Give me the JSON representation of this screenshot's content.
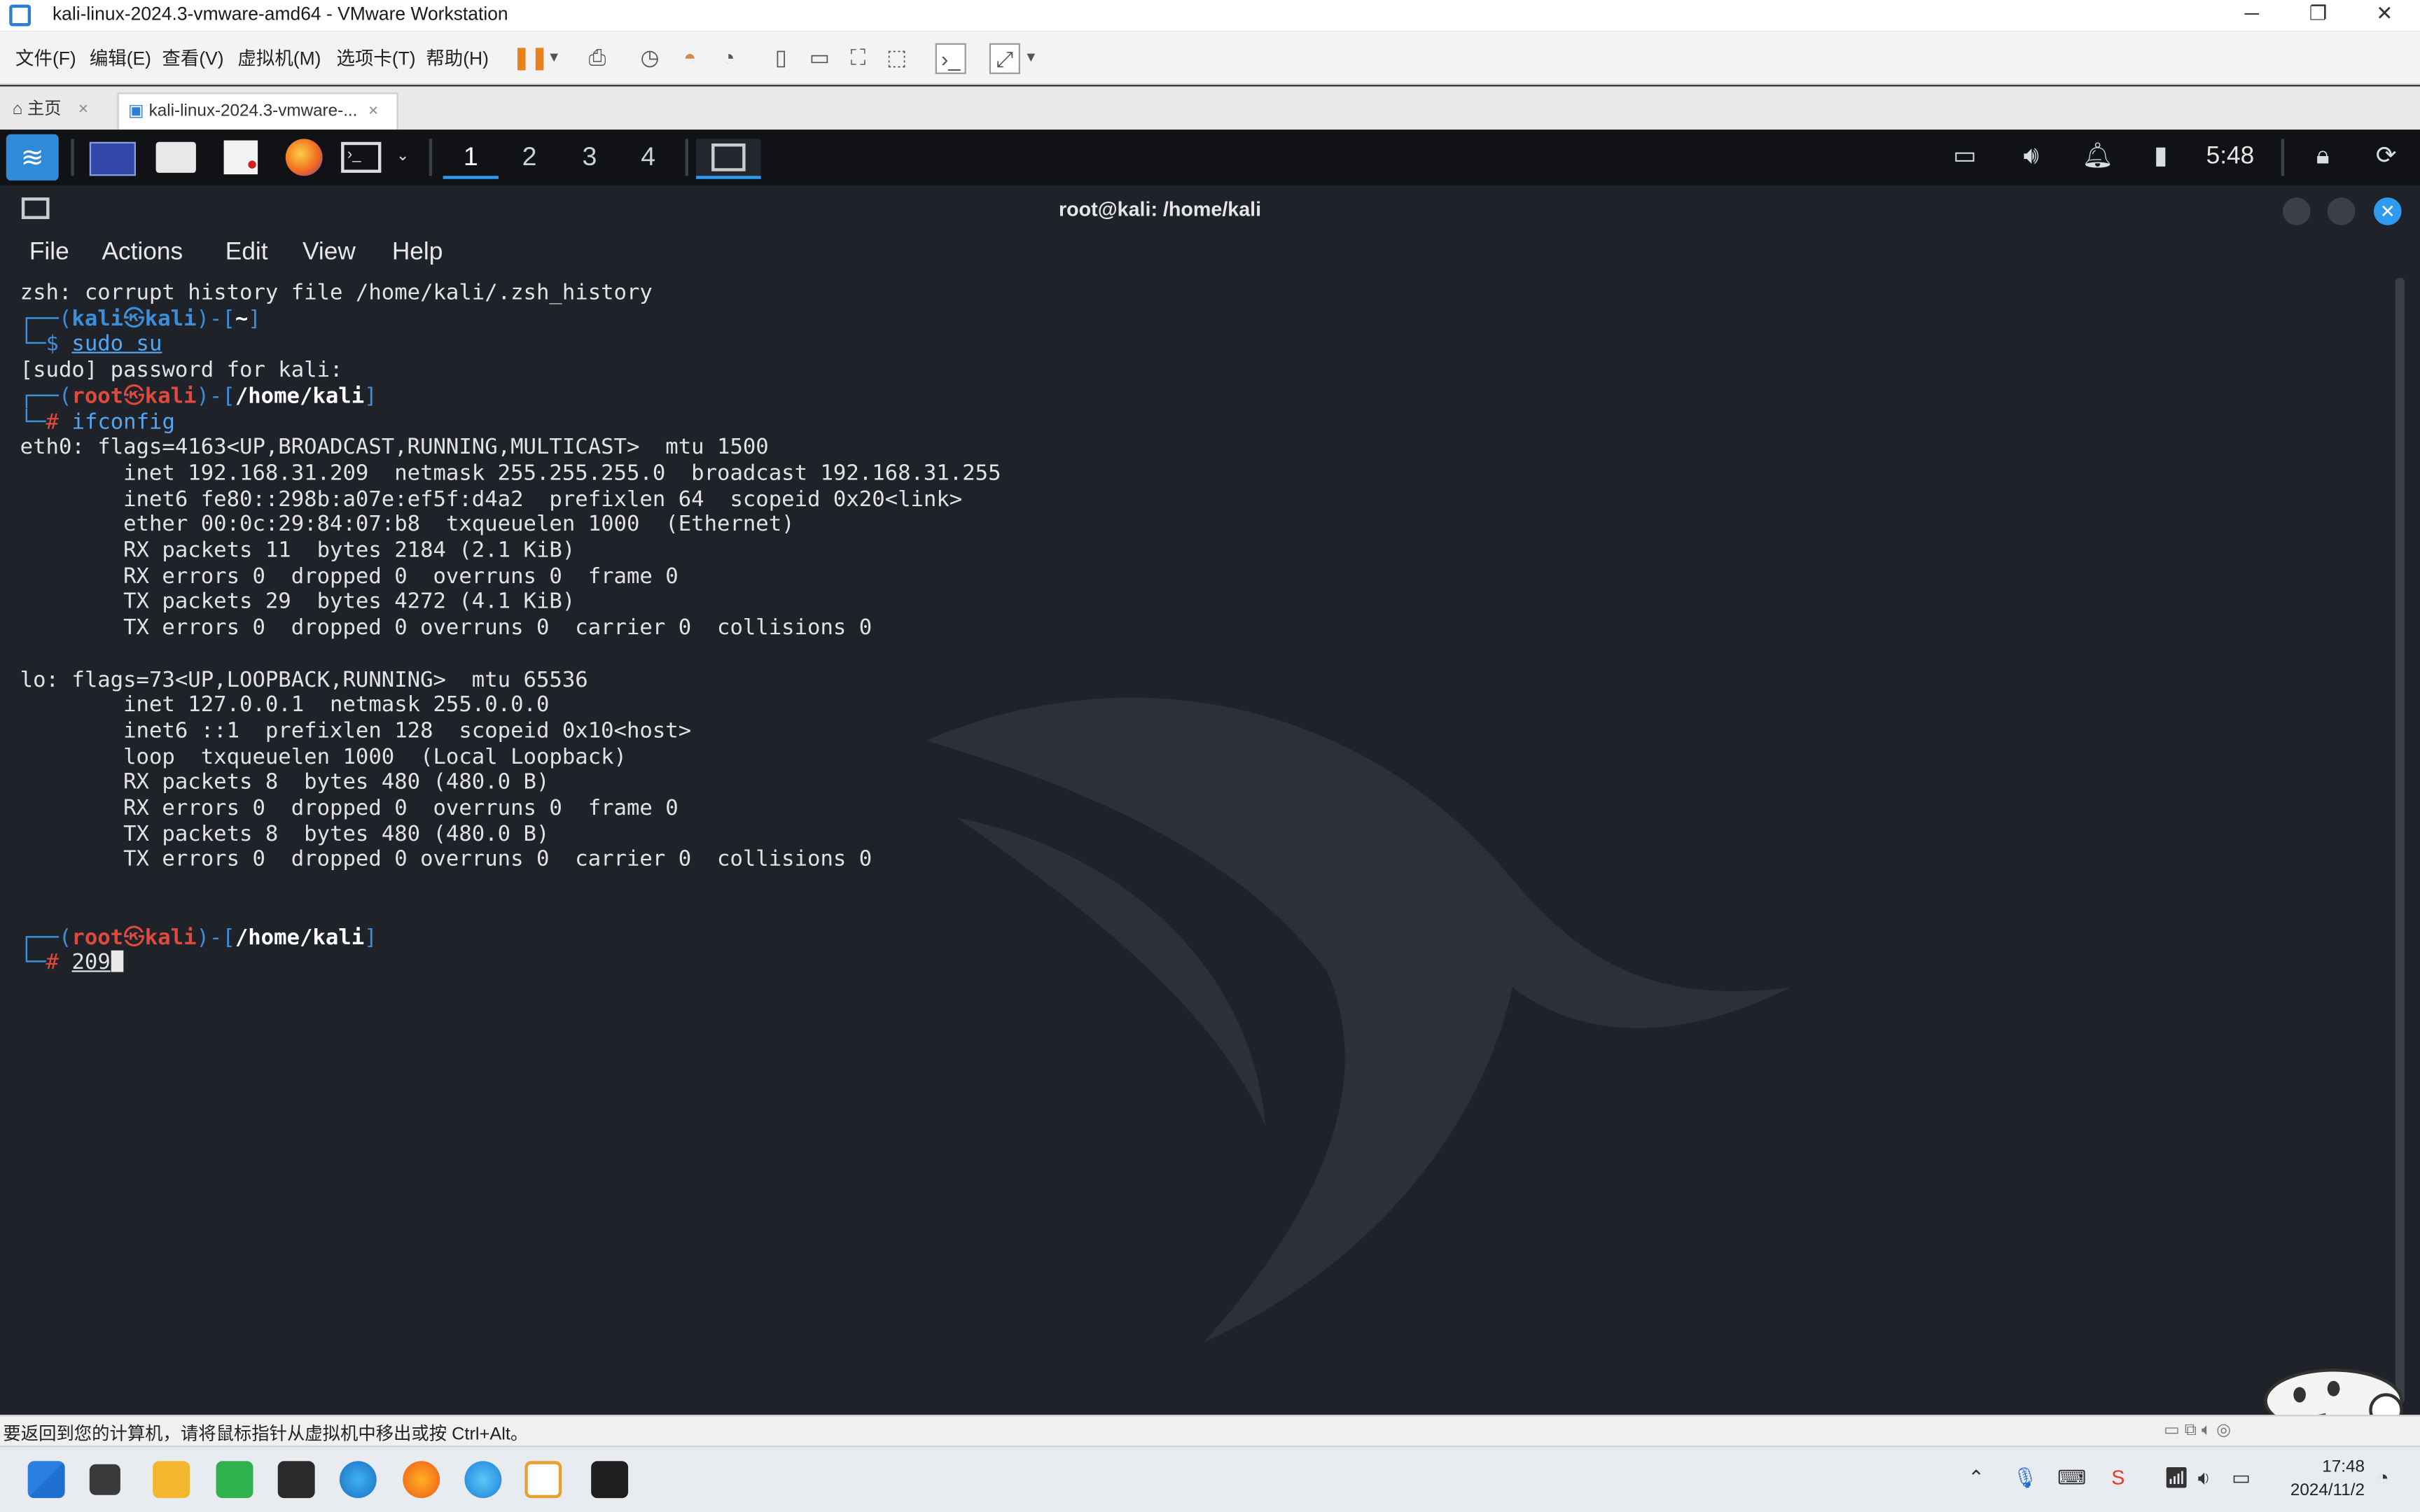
{
  "window": {
    "title": "kali-linux-2024.3-vmware-amd64 - VMware Workstation",
    "minimize": "─",
    "restore": "❐",
    "close": "✕"
  },
  "menubar": {
    "items": [
      "文件(F)",
      "编辑(E)",
      "查看(V)",
      "虚拟机(M)",
      "选项卡(T)",
      "帮助(H)"
    ]
  },
  "tabs": {
    "home": "主页",
    "vm": "kali-linux-2024.3-vmware-...",
    "close": "×"
  },
  "kali_panel": {
    "workspaces": [
      "1",
      "2",
      "3",
      "4"
    ],
    "time": "5:48"
  },
  "terminal": {
    "title": "root@kali: /home/kali",
    "menu": [
      "File",
      "Actions",
      "Edit",
      "View",
      "Help"
    ],
    "lines": {
      "l1": "zsh: corrupt history file /home/kali/.zsh_history",
      "p1_user": "kali",
      "p1_host": "kali",
      "p1_dir": "~",
      "p1_cmd": "sudo su",
      "l_sudo": "[sudo] password for kali:",
      "p2_user": "root",
      "p2_host": "kali",
      "p2_dir": "/home/kali",
      "p2_cmd": "ifconfig",
      "eth0_1": "eth0: flags=4163<UP,BROADCAST,RUNNING,MULTICAST>  mtu 1500",
      "eth0_2": "        inet 192.168.31.209  netmask 255.255.255.0  broadcast 192.168.31.255",
      "eth0_3": "        inet6 fe80::298b:a07e:ef5f:d4a2  prefixlen 64  scopeid 0x20<link>",
      "eth0_4": "        ether 00:0c:29:84:07:b8  txqueuelen 1000  (Ethernet)",
      "eth0_5": "        RX packets 11  bytes 2184 (2.1 KiB)",
      "eth0_6": "        RX errors 0  dropped 0  overruns 0  frame 0",
      "eth0_7": "        TX packets 29  bytes 4272 (4.1 KiB)",
      "eth0_8": "        TX errors 0  dropped 0 overruns 0  carrier 0  collisions 0",
      "lo_1": "lo: flags=73<UP,LOOPBACK,RUNNING>  mtu 65536",
      "lo_2": "        inet 127.0.0.1  netmask 255.0.0.0",
      "lo_3": "        inet6 ::1  prefixlen 128  scopeid 0x10<host>",
      "lo_4": "        loop  txqueuelen 1000  (Local Loopback)",
      "lo_5": "        RX packets 8  bytes 480 (480.0 B)",
      "lo_6": "        RX errors 0  dropped 0  overruns 0  frame 0",
      "lo_7": "        TX packets 8  bytes 480 (480.0 B)",
      "lo_8": "        TX errors 0  dropped 0 overruns 0  carrier 0  collisions 0",
      "p3_user": "root",
      "p3_host": "kali",
      "p3_dir": "/home/kali",
      "p3_input": "209"
    }
  },
  "statusbar": {
    "message": "要返回到您的计算机，请将鼠标指针从虚拟机中移出或按 Ctrl+Alt。"
  },
  "taskbar": {
    "time": "17:48",
    "date": "2024/11/2"
  },
  "colors": {
    "terminal_bg": "#1f2229",
    "prompt_blue": "#3a8fdc",
    "root_red": "#e0493c",
    "command_blue": "#52a6f2",
    "kali_accent": "#2f9bf0"
  }
}
